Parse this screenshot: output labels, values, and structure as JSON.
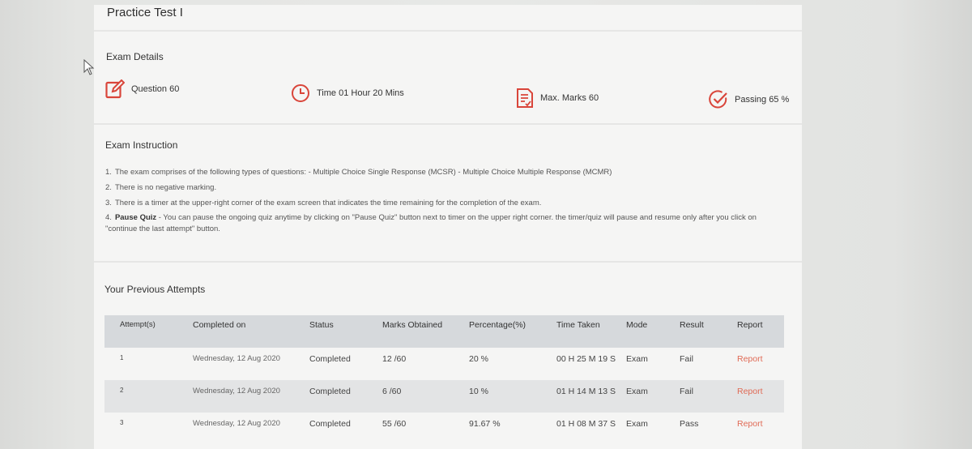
{
  "page": {
    "title": "Practice Test I"
  },
  "exam_details": {
    "heading": "Exam Details",
    "items": [
      {
        "icon": "edit-icon",
        "label": "Question 60"
      },
      {
        "icon": "clock-icon",
        "label": "Time 01 Hour 20 Mins"
      },
      {
        "icon": "document-icon",
        "label": "Max. Marks 60"
      },
      {
        "icon": "check-circle-icon",
        "label": "Passing 65 %"
      }
    ]
  },
  "instructions": {
    "heading": "Exam Instruction",
    "items": [
      {
        "num": "1.",
        "bold": "",
        "text": "The exam comprises of the following types of questions: - Multiple Choice Single Response (MCSR) - Multiple Choice Multiple Response (MCMR)"
      },
      {
        "num": "2.",
        "bold": "",
        "text": "There is no negative marking."
      },
      {
        "num": "3.",
        "bold": "",
        "text": "There is a timer at the upper-right corner of the exam screen that indicates the time remaining for the completion of the exam."
      },
      {
        "num": "4.",
        "bold": "Pause Quiz",
        "text": " - You can pause the ongoing quiz anytime by clicking on \"Pause Quiz\" button next to timer on the upper right corner. the timer/quiz will pause and resume only after you click on \"continue the last attempt\" button."
      }
    ]
  },
  "attempts": {
    "heading": "Your Previous Attempts",
    "columns": [
      "Attempt(s)",
      "Completed on",
      "Status",
      "Marks Obtained",
      "Percentage(%)",
      "Time Taken",
      "Mode",
      "Result",
      "Report"
    ],
    "rows": [
      {
        "attempt": "1",
        "completed_on": "Wednesday, 12 Aug 2020",
        "status": "Completed",
        "marks": "12 /60",
        "percentage": "20 %",
        "time_taken": "00 H 25 M 19 S",
        "mode": "Exam",
        "result": "Fail",
        "report": "Report"
      },
      {
        "attempt": "2",
        "completed_on": "Wednesday, 12 Aug 2020",
        "status": "Completed",
        "marks": "6 /60",
        "percentage": "10 %",
        "time_taken": "01 H 14 M 13 S",
        "mode": "Exam",
        "result": "Fail",
        "report": "Report"
      },
      {
        "attempt": "3",
        "completed_on": "Wednesday, 12 Aug 2020",
        "status": "Completed",
        "marks": "55 /60",
        "percentage": "91.67 %",
        "time_taken": "01 H 08 M 37 S",
        "mode": "Exam",
        "result": "Pass",
        "report": "Report"
      }
    ]
  },
  "colors": {
    "accent": "#d9453a",
    "link": "#e06a55",
    "header_bg": "#d6d9dc"
  }
}
